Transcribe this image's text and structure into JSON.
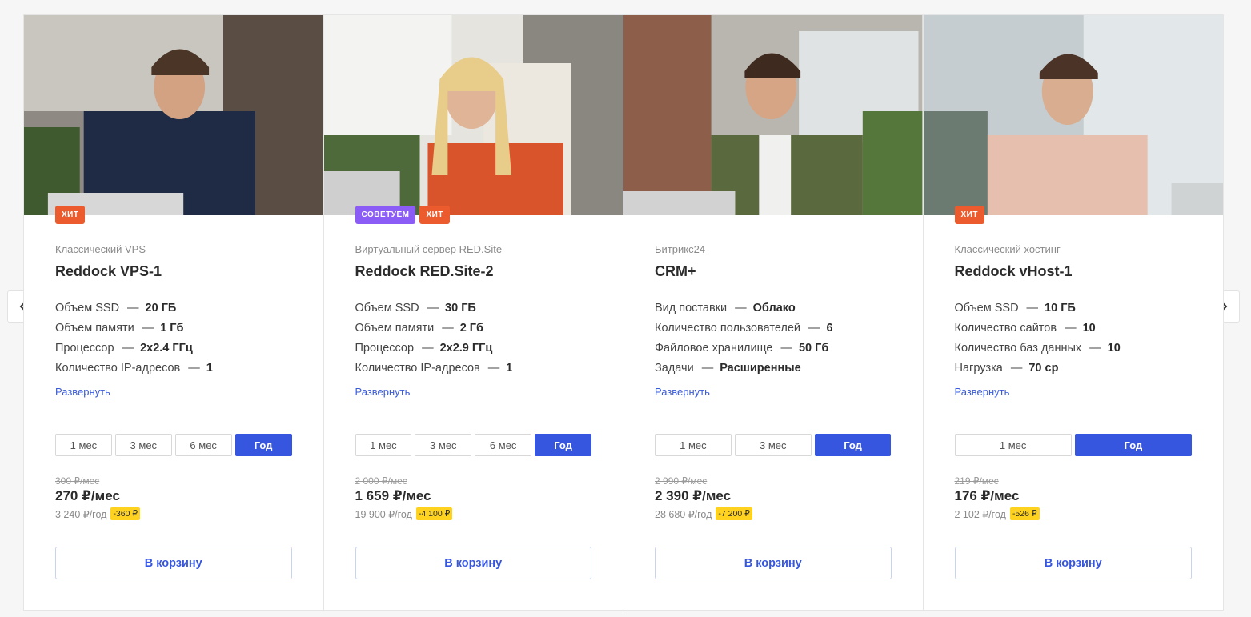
{
  "colors": {
    "accent": "#3656e0",
    "hit_badge": "#ec5b2d",
    "advise_badge": "#8b5cf6",
    "save_badge": "#ffd21f"
  },
  "cards": [
    {
      "badges": [
        "ХИТ"
      ],
      "category": "Классический VPS",
      "title": "Reddock VPS-1",
      "specs": [
        {
          "label": "Объем SSD",
          "value": "20 ГБ"
        },
        {
          "label": "Объем памяти",
          "value": "1 Гб"
        },
        {
          "label": "Процессор",
          "value": "2х2.4 ГГц"
        },
        {
          "label": "Количество IP-адресов",
          "value": "1"
        }
      ],
      "expand": "Развернуть",
      "periods": [
        "1 мес",
        "3 мес",
        "6 мес",
        "Год"
      ],
      "active_period": "Год",
      "old_price": "300 ₽/мес",
      "price": "270 ₽/мес",
      "year_price": "3 240 ₽/год",
      "saving": "-360 ₽",
      "cart": "В корзину"
    },
    {
      "badges": [
        "СОВЕТУЕМ",
        "ХИТ"
      ],
      "category": "Виртуальный сервер RED.Site",
      "title": "Reddock RED.Site-2",
      "specs": [
        {
          "label": "Объем SSD",
          "value": "30 ГБ"
        },
        {
          "label": "Объем памяти",
          "value": "2 Гб"
        },
        {
          "label": "Процессор",
          "value": "2х2.9 ГГц"
        },
        {
          "label": "Количество IP-адресов",
          "value": "1"
        }
      ],
      "expand": "Развернуть",
      "periods": [
        "1 мес",
        "3 мес",
        "6 мес",
        "Год"
      ],
      "active_period": "Год",
      "old_price": "2 000 ₽/мес",
      "price": "1 659 ₽/мес",
      "year_price": "19 900 ₽/год",
      "saving": "-4 100 ₽",
      "cart": "В корзину"
    },
    {
      "badges": [],
      "category": "Битрикс24",
      "title": "CRM+",
      "specs": [
        {
          "label": "Вид поставки",
          "value": "Облако"
        },
        {
          "label": "Количество пользователей",
          "value": "6"
        },
        {
          "label": "Файловое хранилище",
          "value": "50 Гб"
        },
        {
          "label": "Задачи",
          "value": "Расширенные"
        }
      ],
      "expand": "Развернуть",
      "periods": [
        "1 мес",
        "3 мес",
        "Год"
      ],
      "active_period": "Год",
      "old_price": "2 990 ₽/мес",
      "price": "2 390 ₽/мес",
      "year_price": "28 680 ₽/год",
      "saving": "-7 200 ₽",
      "cart": "В корзину"
    },
    {
      "badges": [
        "ХИТ"
      ],
      "category": "Классический хостинг",
      "title": "Reddock vHost-1",
      "specs": [
        {
          "label": "Объем SSD",
          "value": "10 ГБ"
        },
        {
          "label": "Количество сайтов",
          "value": "10"
        },
        {
          "label": "Количество баз данных",
          "value": "10"
        },
        {
          "label": "Нагрузка",
          "value": "70 cp"
        }
      ],
      "expand": "Развернуть",
      "periods": [
        "1 мес",
        "Год"
      ],
      "active_period": "Год",
      "old_price": "219 ₽/мес",
      "price": "176 ₽/мес",
      "year_price": "2 102 ₽/год",
      "saving": "-526 ₽",
      "cart": "В корзину"
    }
  ]
}
